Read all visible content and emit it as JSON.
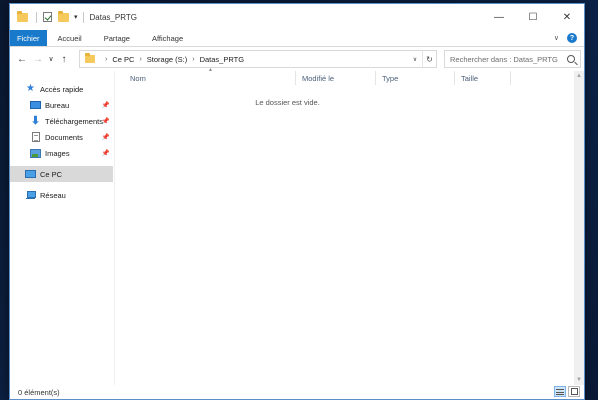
{
  "window": {
    "title": "Datas_PRTG",
    "controls": {
      "minimize": "—",
      "maximize": "☐",
      "close": "✕"
    }
  },
  "ribbon": {
    "tabs": [
      {
        "label": "Fichier",
        "active": true
      },
      {
        "label": "Accueil"
      },
      {
        "label": "Partage"
      },
      {
        "label": "Affichage"
      }
    ]
  },
  "address": {
    "crumbs": [
      "Ce PC",
      "Storage (S:)",
      "Datas_PRTG"
    ]
  },
  "search": {
    "placeholder": "Rechercher dans : Datas_PRTG"
  },
  "navpane": {
    "quick_access": "Accès rapide",
    "items": [
      {
        "label": "Bureau",
        "icon": "desktop-icon",
        "pinned": true
      },
      {
        "label": "Téléchargements",
        "icon": "download-icon",
        "pinned": true
      },
      {
        "label": "Documents",
        "icon": "documents-icon",
        "pinned": true
      },
      {
        "label": "Images",
        "icon": "images-icon",
        "pinned": true
      }
    ],
    "this_pc": "Ce PC",
    "network": "Réseau"
  },
  "content": {
    "columns": [
      "Nom",
      "Modifié le",
      "Type",
      "Taille"
    ],
    "empty_message": "Le dossier est vide."
  },
  "statusbar": {
    "count": "0 élément(s)"
  },
  "colors": {
    "accent": "#1979ca",
    "selection": "#d9d9d9"
  }
}
